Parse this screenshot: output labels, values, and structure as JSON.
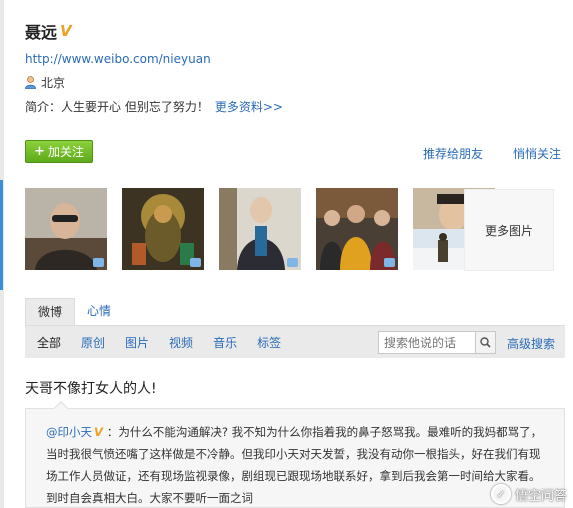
{
  "profile": {
    "name": "聂远",
    "verified_badge": "V",
    "url": "http://www.weibo.com/nieyuan",
    "location": "北京",
    "intro_label": "简介：",
    "intro_text": "人生要开心 但别忘了努力！",
    "more_info": "更多资料>>"
  },
  "actions": {
    "follow_plus": "+",
    "follow_label": "加关注",
    "recommend": "推荐给朋友",
    "quiet_follow": "悄悄关注"
  },
  "photos": {
    "more_label": "更多图片"
  },
  "tabs": [
    "微博",
    "心情"
  ],
  "filters": [
    "全部",
    "原创",
    "图片",
    "视频",
    "音乐",
    "标签"
  ],
  "search": {
    "placeholder": "搜索他说的话",
    "advanced": "高级搜索"
  },
  "post": {
    "title": "天哥不像打女人的人!",
    "quote_author": "@印小天",
    "quote_badge": "V",
    "quote_colon": "：",
    "quote_text": "为什么不能沟通解决? 我不知为什么你指着我的鼻子怒骂我。最难听的我妈都骂了，当时我很气愤还嘴了这样做是不冷静。但我印小天对天发誓，我没有动你一根指头，好在我们有现场工作人员做证，还有现场监视录像，剧组现已跟现场地联系好，拿到后我会第一时间给大家看。到时自会真相大白。大家不要听一面之词"
  },
  "watermark": {
    "text": "悟空问答"
  },
  "colors": {
    "link": "#2a6bb8",
    "follow_button": "#6cb82a",
    "verified": "#f0a020"
  }
}
